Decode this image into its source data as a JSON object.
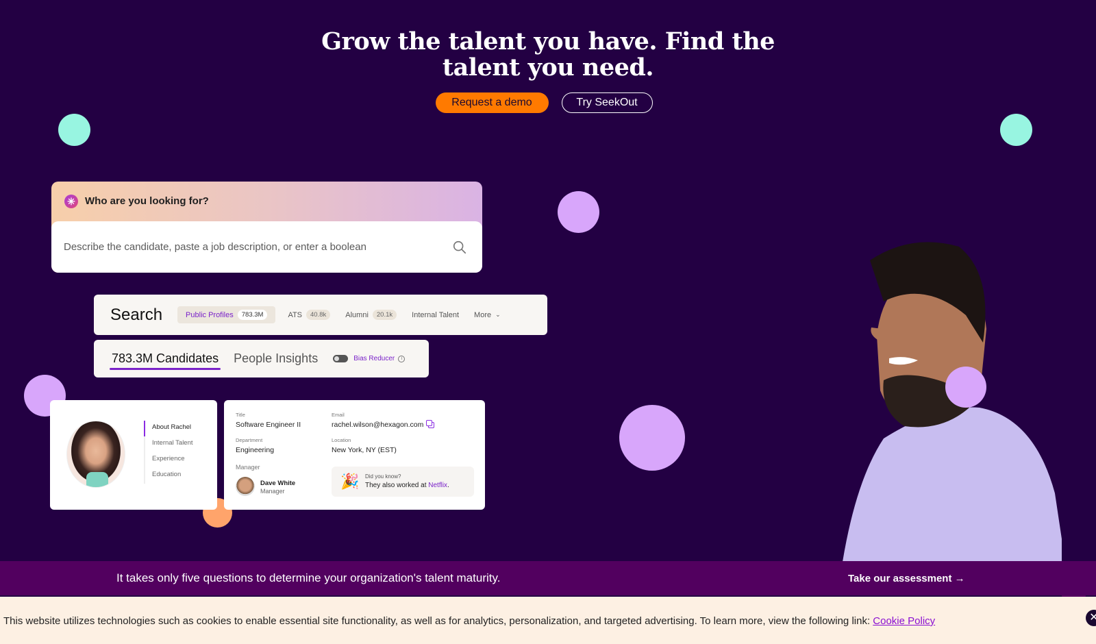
{
  "hero": {
    "title_line1": "Grow the talent you have. Find the",
    "title_line2": "talent you need.",
    "primary_cta": "Request a demo",
    "secondary_cta": "Try SeekOut"
  },
  "colors": {
    "background": "#230043",
    "primary_cta": "#ff7a00",
    "accent_purple": "#7a22c9",
    "banner": "#52005f",
    "cookie_bg": "#fdf0e3",
    "mint": "#98f5e1",
    "lilac": "#d8a6fb",
    "peach": "#ffa46b"
  },
  "prompt": {
    "icon": "sparkle-icon",
    "label": "Who are you looking for?",
    "placeholder": "Describe the candidate, paste a job description, or enter a boolean",
    "search_icon": "search-icon"
  },
  "search": {
    "title": "Search",
    "tabs": [
      {
        "label": "Public Profiles",
        "count": "783.3M",
        "active": true
      },
      {
        "label": "ATS",
        "count": "40.8k"
      },
      {
        "label": "Alumni",
        "count": "20.1k"
      },
      {
        "label": "Internal Talent"
      },
      {
        "label": "More",
        "icon": "chevron-down-icon"
      }
    ]
  },
  "candidates": {
    "active_tab": "783.3M Candidates",
    "other_tab": "People Insights",
    "toggle_label": "Bias Reducer",
    "toggle_on": false
  },
  "profile": {
    "nav": [
      "About Rachel",
      "Internal Talent",
      "Experience",
      "Education"
    ],
    "active_nav": "About Rachel"
  },
  "details": {
    "title_label": "Title",
    "title_value": "Software Engineer II",
    "email_label": "Email",
    "email_value": "rachel.wilson@hexagon.com",
    "department_label": "Department",
    "department_value": "Engineering",
    "location_label": "Location",
    "location_value": "New York, NY (EST)",
    "manager_label": "Manager",
    "manager_name": "Dave White",
    "manager_role": "Manager",
    "dyk_label": "Did you know?",
    "dyk_text": "They also worked at ",
    "dyk_company": "Netflix",
    "dyk_suffix": "."
  },
  "banner": {
    "text": "It takes only five questions to determine your organization's talent maturity.",
    "link": "Take our assessment →"
  },
  "cookie": {
    "text": "This website utilizes technologies such as cookies to enable essential site functionality, as well as for analytics, personalization, and targeted advertising. To learn more, view the following link: ",
    "link": "Cookie Policy",
    "close": "✕"
  }
}
